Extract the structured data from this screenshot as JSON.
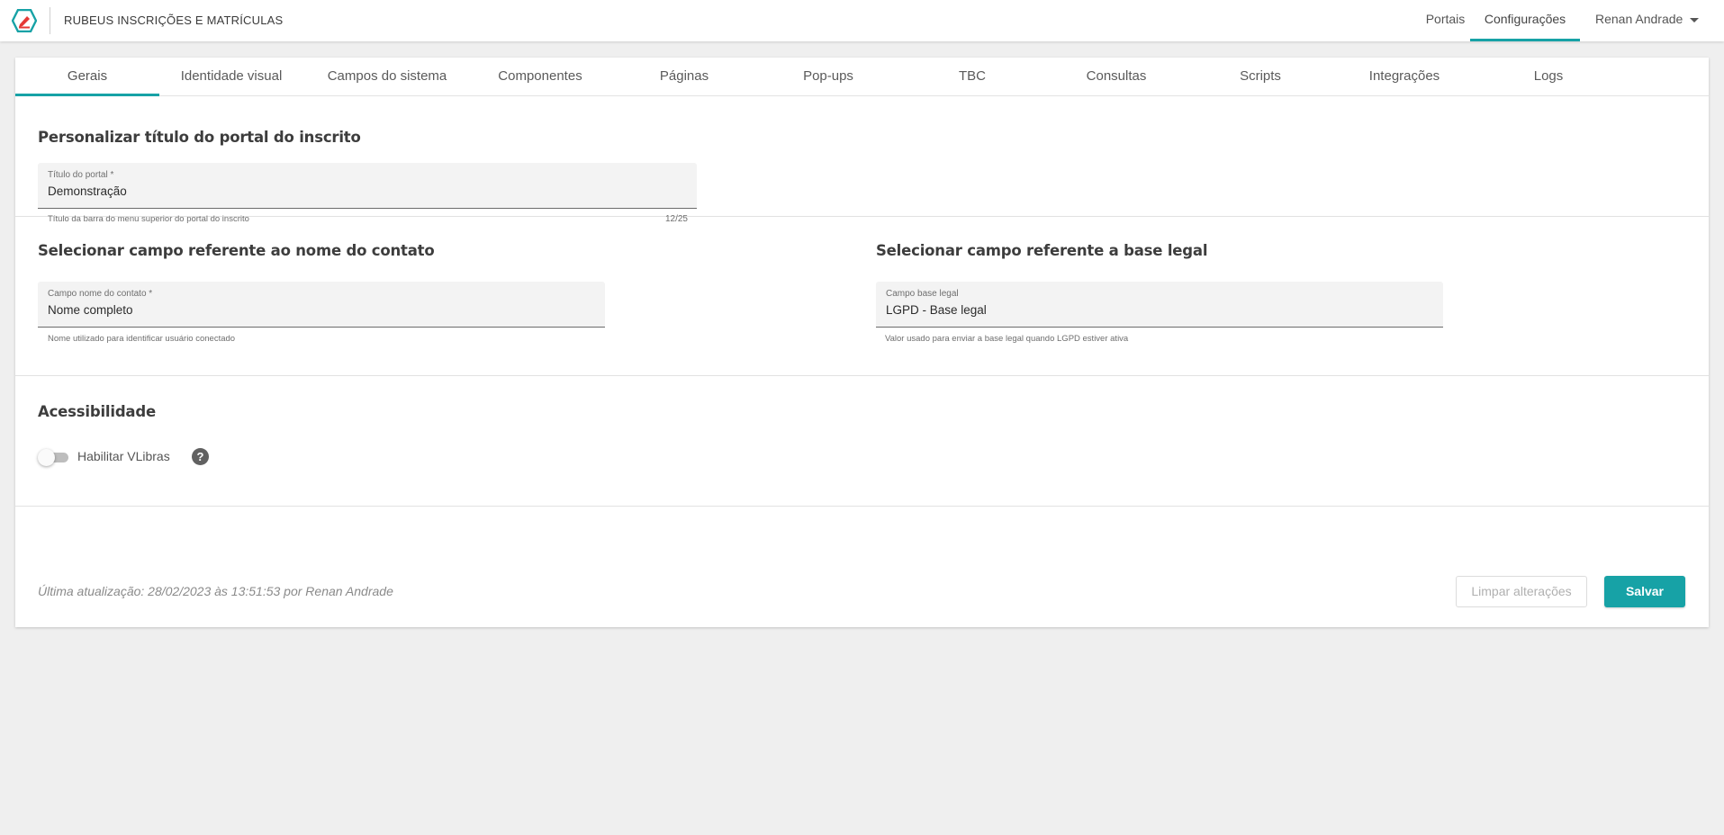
{
  "header": {
    "app_title": "RUBEUS INSCRIÇÕES E MATRÍCULAS",
    "logo_icon": "rubeus-logo-icon",
    "nav": {
      "portais": "Portais",
      "configuracoes": "Configurações",
      "user": "Renan Andrade"
    },
    "accent_color": "#17a2a6"
  },
  "tabs": [
    {
      "label": "Gerais",
      "active": true
    },
    {
      "label": "Identidade visual",
      "active": false
    },
    {
      "label": "Campos do sistema",
      "active": false
    },
    {
      "label": "Componentes",
      "active": false
    },
    {
      "label": "Páginas",
      "active": false
    },
    {
      "label": "Pop-ups",
      "active": false
    },
    {
      "label": "TBC",
      "active": false
    },
    {
      "label": "Consultas",
      "active": false
    },
    {
      "label": "Scripts",
      "active": false
    },
    {
      "label": "Integrações",
      "active": false
    },
    {
      "label": "Logs",
      "active": false
    }
  ],
  "portal_title_section": {
    "title": "Personalizar título do portal do inscrito",
    "field": {
      "label": "Título do portal *",
      "value": "Demonstração",
      "hint": "Título da barra do menu superior do portal do inscrito",
      "counter": "12/25"
    }
  },
  "contact_name_section": {
    "title": "Selecionar campo referente ao nome do contato",
    "field": {
      "label": "Campo nome do contato *",
      "value": "Nome completo",
      "hint": "Nome utilizado para identificar usuário conectado"
    }
  },
  "legal_basis_section": {
    "title": "Selecionar campo referente a base legal",
    "field": {
      "label": "Campo base legal",
      "value": "LGPD - Base legal",
      "hint": "Valor usado para enviar a base legal quando LGPD estiver ativa"
    }
  },
  "accessibility_section": {
    "title": "Acessibilidade",
    "toggle_label": "Habilitar VLibras",
    "toggle_on": false,
    "help_glyph": "?"
  },
  "footer": {
    "last_update": "Última atualização: 28/02/2023 às 13:51:53 por Renan Andrade",
    "clear_button": "Limpar alterações",
    "save_button": "Salvar"
  }
}
